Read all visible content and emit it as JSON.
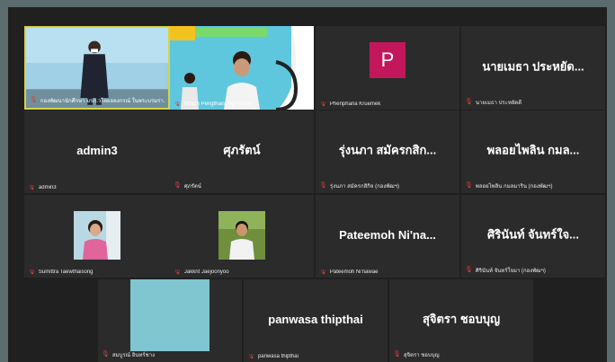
{
  "tiles": [
    {
      "id": "t1",
      "label": "กองพัฒนานักศึกษา มรภ.วไลยอลงกรณ์ ในพระบรมรา..."
    },
    {
      "id": "t2",
      "label": "Nitach Pengthaisong PaTam"
    },
    {
      "id": "t3",
      "label": "Phenphana Kruemek",
      "initial": "P"
    },
    {
      "id": "t4",
      "name": "นายเมธา ประหยัด...",
      "label": "นายเมธา ประหยัดดี"
    },
    {
      "id": "t5",
      "name": "admin3",
      "label": "admin3"
    },
    {
      "id": "t6",
      "name": "ศุภรัตน์",
      "label": "ศุภรัตน์"
    },
    {
      "id": "t7",
      "name": "รุ่งนภา สมัครกสิก...",
      "label": "รุ่งนภา สมัครกสิกิจ (กองพัฒฯ)"
    },
    {
      "id": "t8",
      "name": "พลอยไพลิน กมล...",
      "label": "พลอยไพลิน กมลมาริน (กองพัฒฯ)"
    },
    {
      "id": "t9",
      "label": "Sumittra Taewthaisong"
    },
    {
      "id": "t10",
      "label": "Jakkrit Jaejoonyoo"
    },
    {
      "id": "t11",
      "name": "Pateemoh  Ni'na...",
      "label": "Pateemoh Ni'nawae"
    },
    {
      "id": "t12",
      "name": "ศิรินันท์ จันทร์ใจ...",
      "label": "ศิรินันท์ จันทร์ใจมา (กองพัฒฯ)"
    },
    {
      "id": "t13",
      "label": "สมบูรณ์ อินทร์ชาง"
    },
    {
      "id": "t14",
      "name": "panwasa thipthai",
      "label": "panwasa thipthai"
    },
    {
      "id": "t15",
      "name": "สุจิตรา ชอบบุญ",
      "label": "สุจิตรา ชอบบุญ"
    }
  ],
  "colors": {
    "active_border": "#d6d34a",
    "mic_muted": "#e03a3a",
    "avatar_bg": "#c2185b",
    "tile_bg": "#2b2b2b"
  },
  "icons": {
    "muted_mic": "mic-muted-icon"
  }
}
